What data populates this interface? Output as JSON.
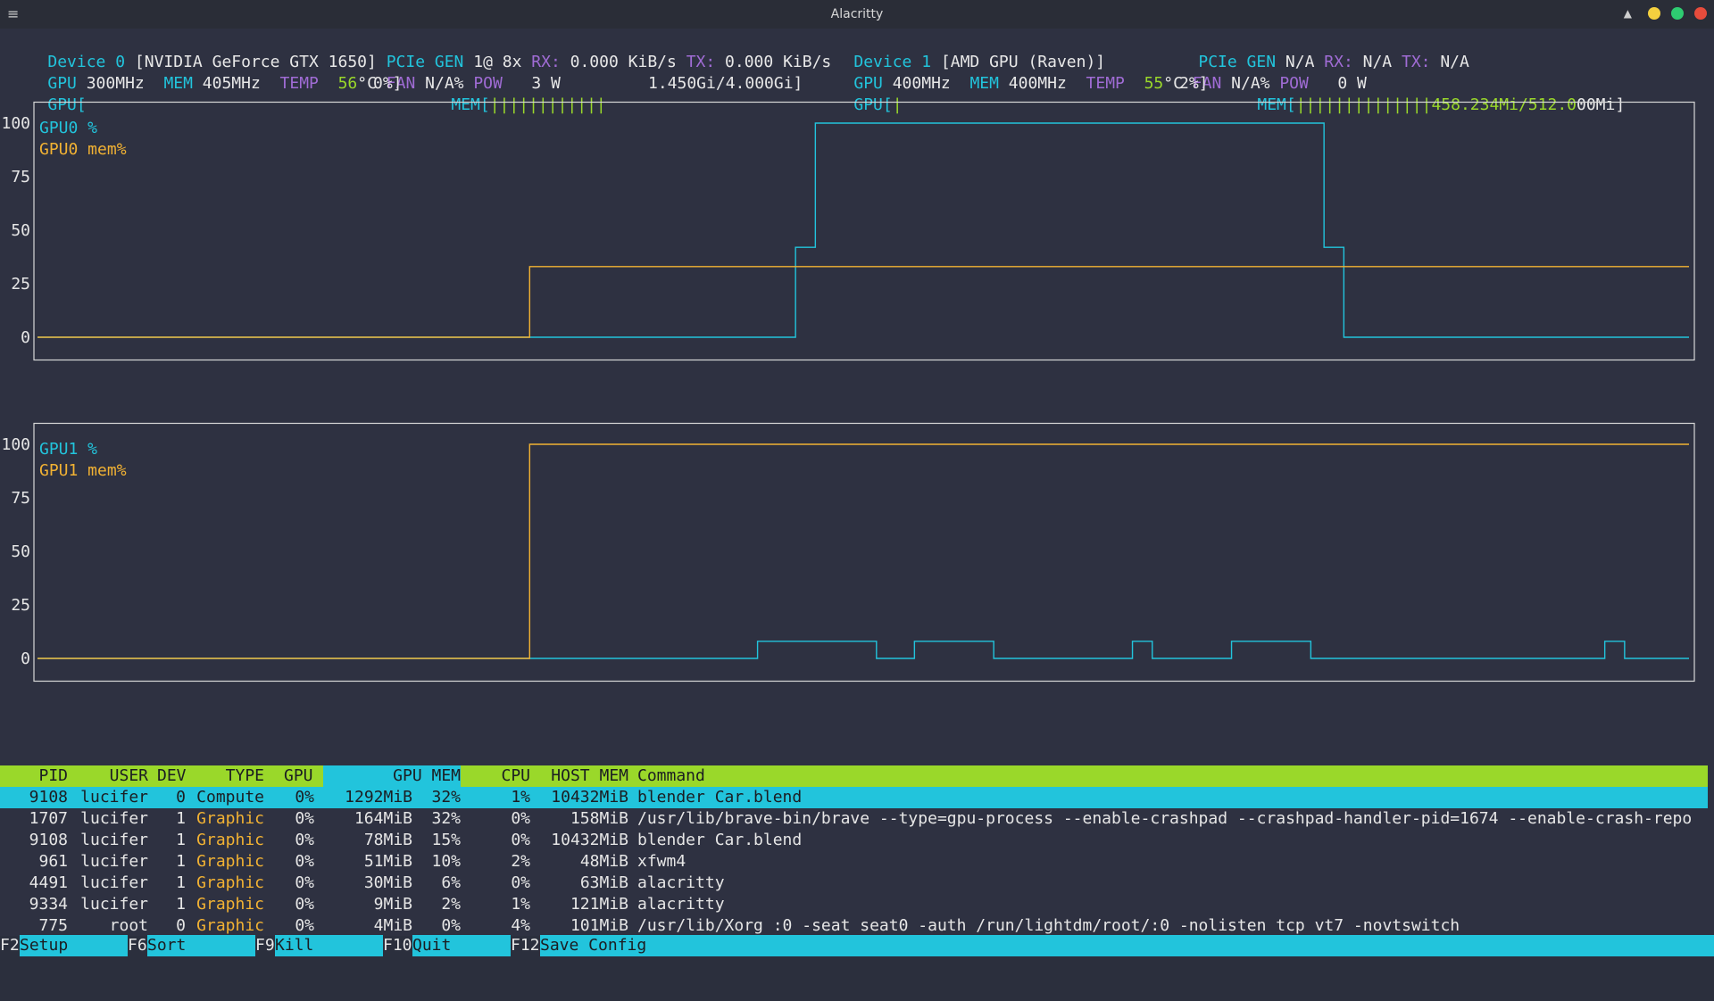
{
  "window": {
    "title": "Alacritty",
    "controls": {
      "minimize_color": "#f4d03f",
      "maximize_color": "#2ecc71",
      "close_color": "#e74c3c"
    }
  },
  "devices": [
    {
      "label": "Device 0",
      "name": "[NVIDIA GeForce GTX 1650]",
      "pcie_label": "PCIe GEN",
      "pcie_value": "1@ 8x",
      "rx_label": "RX:",
      "rx_value": "0.000 KiB/s",
      "tx_label": "TX:",
      "tx_value": "0.000 KiB/s",
      "gpu_label": "GPU",
      "gpu_clock": "300MHz",
      "mem_label": "MEM",
      "mem_clock": "405MHz",
      "temp_label": "TEMP",
      "temp_value": "56",
      "temp_unit": "°C",
      "fan_label": "FAN",
      "fan_value": "N/A%",
      "pow_label": "POW",
      "pow_value": "3 W",
      "gpu_bar_label": "GPU[",
      "gpu_bar_fill": "",
      "gpu_bar_value": "0%]",
      "mem_bar_label": "MEM[",
      "mem_bar_fill": "||||||||||||",
      "mem_bar_value": "1.450Gi/4.000Gi]"
    },
    {
      "label": "Device 1",
      "name": "[AMD GPU (Raven)]",
      "pcie_label": "PCIe GEN",
      "pcie_value": "N/A",
      "rx_label": "RX:",
      "rx_value": "N/A",
      "tx_label": "TX:",
      "tx_value": "N/A",
      "gpu_label": "GPU",
      "gpu_clock": "400MHz",
      "mem_label": "MEM",
      "mem_clock": "400MHz",
      "temp_label": "TEMP",
      "temp_value": "55",
      "temp_unit": "°C",
      "fan_label": "FAN",
      "fan_value": "N/A%",
      "pow_label": "POW",
      "pow_value": "0 W",
      "gpu_bar_label": "GPU[",
      "gpu_bar_fill": "|",
      "gpu_bar_value": "2%]",
      "mem_bar_label": "MEM[",
      "mem_bar_fill": "||||||||||||||",
      "mem_bar_value_a": "458.234Mi/512.0",
      "mem_bar_value_b": "00Mi]"
    }
  ],
  "chart_data": [
    {
      "type": "line",
      "legend": [
        "GPU0 %",
        "GPU0 mem%"
      ],
      "y_ticks": [
        "100",
        "75",
        "50",
        "25",
        "0"
      ],
      "ylim": [
        0,
        100
      ],
      "x_samples": 100,
      "series": [
        {
          "name": "GPU0 %",
          "color": "#22c4dc",
          "steps": [
            [
              0,
              0
            ],
            [
              45.9,
              42
            ],
            [
              47.1,
              100
            ],
            [
              77.9,
              42
            ],
            [
              79.1,
              0
            ],
            [
              100,
              0
            ]
          ]
        },
        {
          "name": "GPU0 mem%",
          "color": "#f2b233",
          "steps": [
            [
              0,
              0
            ],
            [
              29.8,
              33
            ],
            [
              100,
              33
            ]
          ]
        }
      ]
    },
    {
      "type": "line",
      "legend": [
        "GPU1 %",
        "GPU1 mem%"
      ],
      "y_ticks": [
        "100",
        "75",
        "50",
        "25",
        "0"
      ],
      "ylim": [
        0,
        100
      ],
      "x_samples": 100,
      "series": [
        {
          "name": "GPU1 %",
          "color": "#22c4dc",
          "steps": [
            [
              0,
              0
            ],
            [
              43.6,
              8
            ],
            [
              50.8,
              0
            ],
            [
              53.1,
              8
            ],
            [
              57.9,
              0
            ],
            [
              66.3,
              8
            ],
            [
              67.5,
              0
            ],
            [
              72.3,
              8
            ],
            [
              77.1,
              0
            ],
            [
              94.9,
              8
            ],
            [
              96.1,
              0
            ],
            [
              100,
              0
            ]
          ]
        },
        {
          "name": "GPU1 mem%",
          "color": "#f2b233",
          "steps": [
            [
              0,
              0
            ],
            [
              29.8,
              100
            ],
            [
              100,
              100
            ]
          ]
        }
      ]
    }
  ],
  "process_table": {
    "headers": {
      "pid": "PID",
      "user": "USER",
      "dev": "DEV",
      "type": "TYPE",
      "gpu": "GPU",
      "gpu_mem": "GPU MEM",
      "cpu": "CPU",
      "host_mem": "HOST MEM",
      "command": "Command"
    },
    "rows": [
      {
        "pid": "9108",
        "user": "lucifer",
        "dev": "0",
        "type": "Compute",
        "gpu": "0%",
        "gpu_mem_abs": "1292MiB",
        "gpu_mem_pct": "32%",
        "cpu": "1%",
        "host_mem": "10432MiB",
        "command": "blender Car.blend",
        "selected": true
      },
      {
        "pid": "1707",
        "user": "lucifer",
        "dev": "1",
        "type": "Graphic",
        "gpu": "0%",
        "gpu_mem_abs": "164MiB",
        "gpu_mem_pct": "32%",
        "cpu": "0%",
        "host_mem": "158MiB",
        "command": "/usr/lib/brave-bin/brave --type=gpu-process --enable-crashpad --crashpad-handler-pid=1674 --enable-crash-repo"
      },
      {
        "pid": "9108",
        "user": "lucifer",
        "dev": "1",
        "type": "Graphic",
        "gpu": "0%",
        "gpu_mem_abs": "78MiB",
        "gpu_mem_pct": "15%",
        "cpu": "0%",
        "host_mem": "10432MiB",
        "command": "blender Car.blend"
      },
      {
        "pid": "961",
        "user": "lucifer",
        "dev": "1",
        "type": "Graphic",
        "gpu": "0%",
        "gpu_mem_abs": "51MiB",
        "gpu_mem_pct": "10%",
        "cpu": "2%",
        "host_mem": "48MiB",
        "command": "xfwm4"
      },
      {
        "pid": "4491",
        "user": "lucifer",
        "dev": "1",
        "type": "Graphic",
        "gpu": "0%",
        "gpu_mem_abs": "30MiB",
        "gpu_mem_pct": "6%",
        "cpu": "0%",
        "host_mem": "63MiB",
        "command": "alacritty"
      },
      {
        "pid": "9334",
        "user": "lucifer",
        "dev": "1",
        "type": "Graphic",
        "gpu": "0%",
        "gpu_mem_abs": "9MiB",
        "gpu_mem_pct": "2%",
        "cpu": "1%",
        "host_mem": "121MiB",
        "command": "alacritty"
      },
      {
        "pid": "775",
        "user": "root",
        "dev": "0",
        "type": "Graphic",
        "gpu": "0%",
        "gpu_mem_abs": "4MiB",
        "gpu_mem_pct": "0%",
        "cpu": "4%",
        "host_mem": "101MiB",
        "command": "/usr/lib/Xorg :0 -seat seat0 -auth /run/lightdm/root/:0 -nolisten tcp vt7 -novtswitch"
      }
    ]
  },
  "function_keys": [
    {
      "key": "F2",
      "label": "Setup"
    },
    {
      "key": "F6",
      "label": "Sort"
    },
    {
      "key": "F9",
      "label": "Kill"
    },
    {
      "key": "F10",
      "label": "Quit"
    },
    {
      "key": "F12",
      "label": "Save Config"
    }
  ]
}
